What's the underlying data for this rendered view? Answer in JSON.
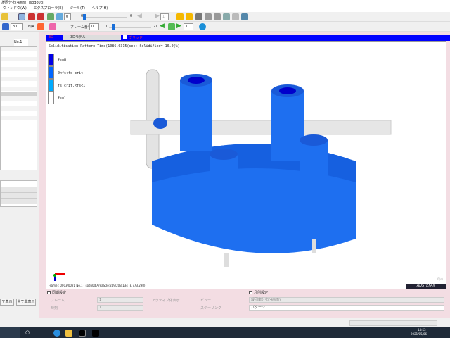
{
  "window": {
    "title": "凝固分布(4画面) [sodo0d]"
  },
  "menu": [
    "ウィンドウ(W)",
    "エクスプローラ(E)",
    "ツール(T)",
    "ヘルプ(H)"
  ],
  "toolbar1": {
    "spin1": "0",
    "slider_min": "0",
    "slider_max": "0",
    "frame_spin": "1"
  },
  "toolbar2": {
    "zoom_spin": "30",
    "na_label": "N/A",
    "frame_no_label": "フレーム番号",
    "frame_no": "0",
    "slider_min": "1",
    "slider_max": "21",
    "step_spin": "1"
  },
  "left_panel": {
    "tab_label": "No.1",
    "buttons": [
      "て表示",
      "全て非表示"
    ]
  },
  "viewport": {
    "header_label": "3D",
    "model_select": "3Dモデル",
    "grid_label": "グリッド",
    "info": "Solidification Pattern   Time(1086.0315(sec)   Solidified= 10.0(%)",
    "legend": [
      {
        "label": "fs=0",
        "color": "#0000e6"
      },
      {
        "label": "0<fs<fs crit.",
        "color": "#0066ff"
      },
      {
        "label": "fs crit.<fs<1",
        "color": "#00aaff"
      },
      {
        "label": "fs=1",
        "color": "#ffffff"
      }
    ],
    "status": "Frame : 0003/0021   No.1 - sodo0d   AreaSize:249/203/134 (8,773,298)",
    "watermark": "ADSTEFAN",
    "corner": "0(s)"
  },
  "controls": {
    "sync_label": "同期設定",
    "frame_label": "フレーム",
    "frame_value": "1",
    "time_label": "時刻",
    "time_value": "1",
    "active_label": "アクティブ化表示",
    "view_label": "ビュー",
    "scaling_label": "スケーリング",
    "geom_label": "凡例設定",
    "select1": "凝固率分布(4画面)",
    "select2": "パターン1"
  },
  "taskbar": {
    "time": "14:53",
    "date": "2021/05/06"
  },
  "colors": {
    "blue": "#0000ff",
    "model": "#1e6ff0",
    "pink": "#f3dde3"
  }
}
